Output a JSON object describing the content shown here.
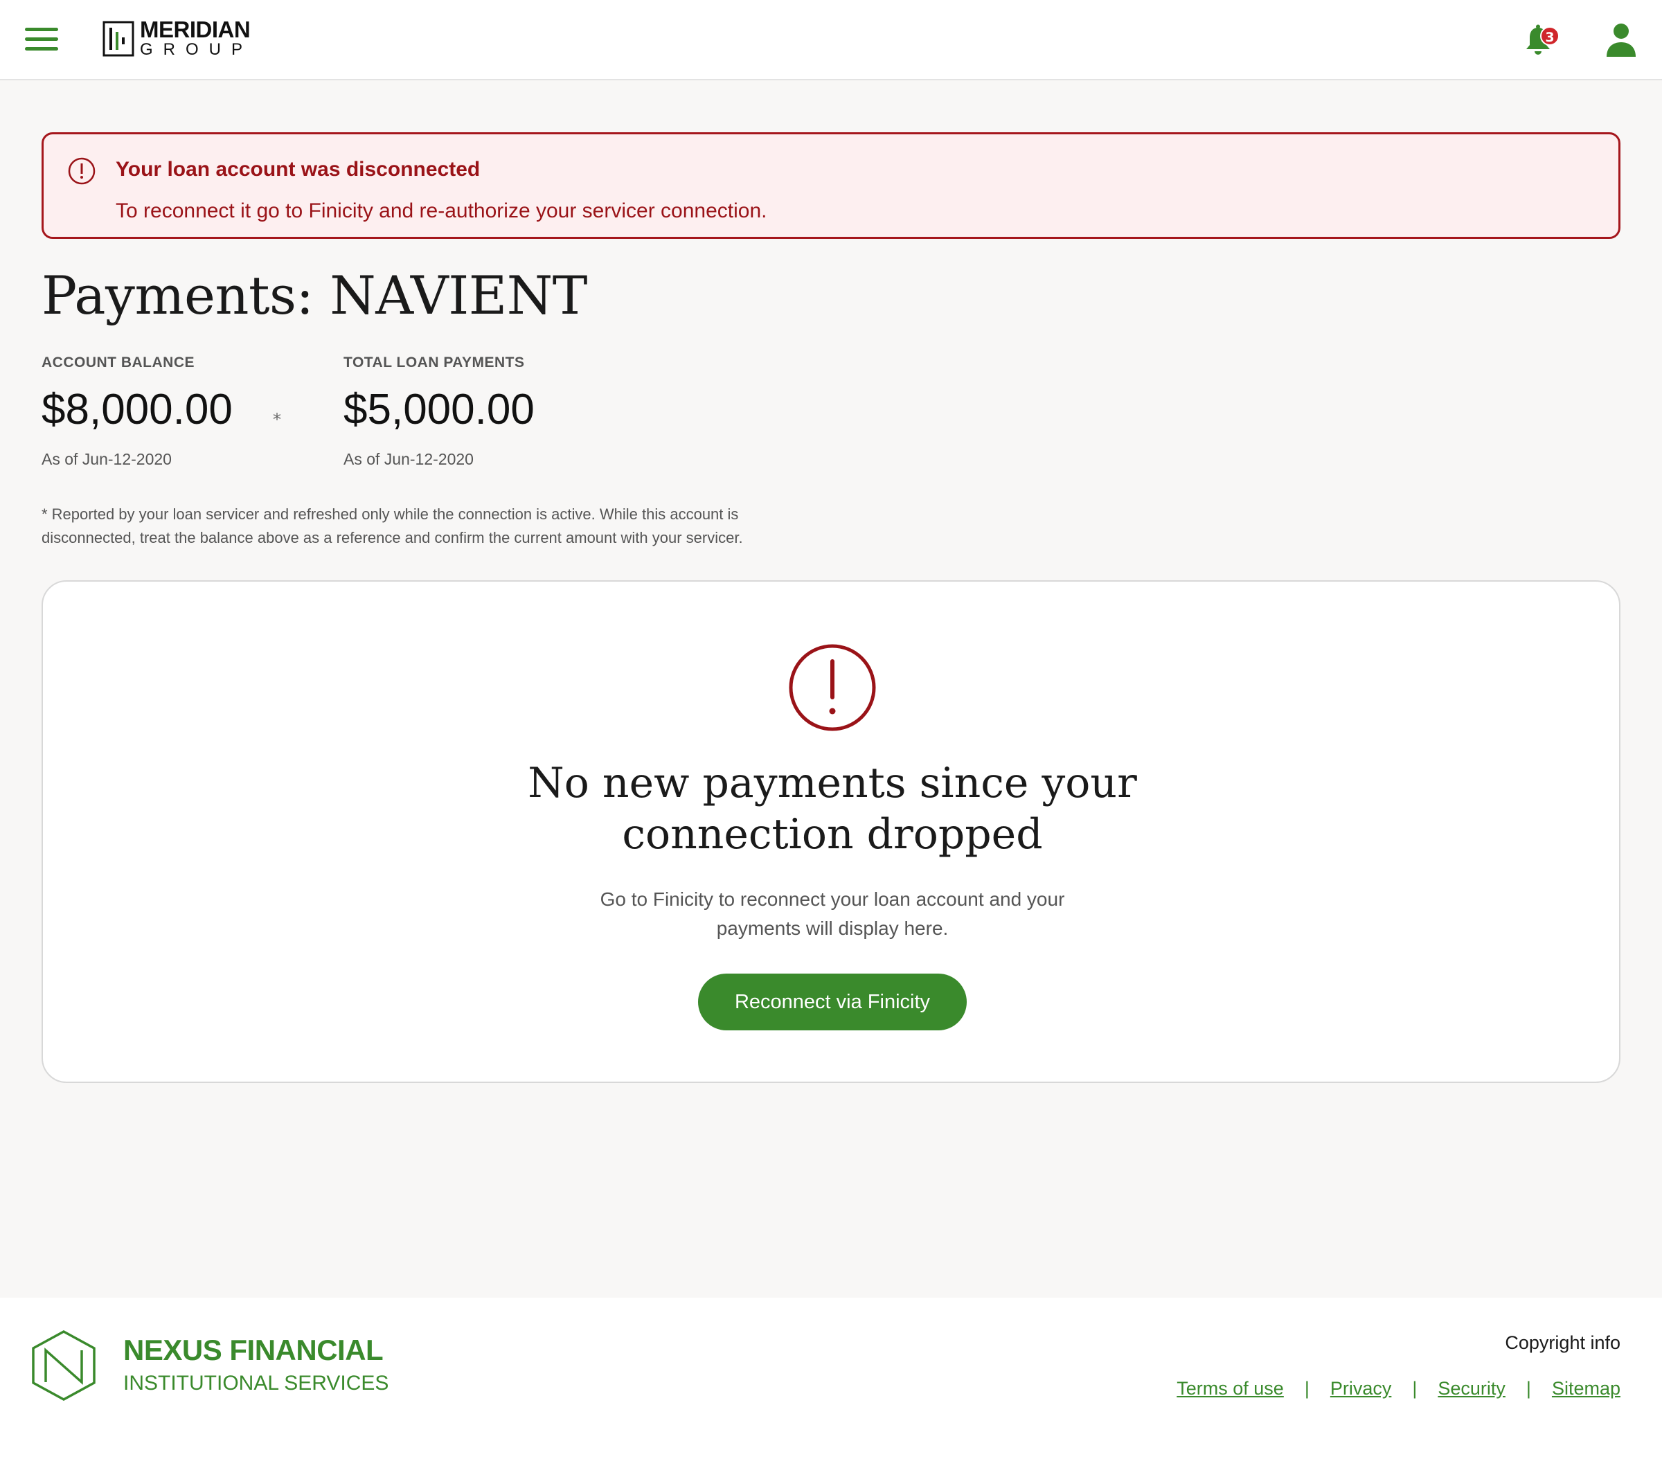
{
  "header": {
    "logo_main": "MERIDIAN",
    "logo_sub": "GROUP",
    "notification_count": "3"
  },
  "alert": {
    "title": "Your loan account was disconnected",
    "message": "To reconnect it go to Finicity and re-authorize your servicer connection."
  },
  "page": {
    "title": "Payments: NAVIENT"
  },
  "stats": {
    "balance_label": "ACCOUNT BALANCE",
    "balance_value": "$8,000.00",
    "balance_marker": "*",
    "balance_date": "As of Jun-12-2020",
    "payments_label": "TOTAL LOAN PAYMENTS",
    "payments_value": "$5,000.00",
    "payments_date": "As of Jun-12-2020"
  },
  "footnote": {
    "line1": "* Reported by your loan servicer and refreshed only while the connection is active. While this account is",
    "line2": "disconnected, treat the balance above as a reference and confirm the current amount with your servicer."
  },
  "empty_state": {
    "title_line1": "No new payments since your",
    "title_line2": "connection dropped",
    "message_line1": "Go to Finicity to reconnect your loan account and your",
    "message_line2": "payments will display here.",
    "button_label": "Reconnect via Finicity"
  },
  "footer": {
    "brand_line1": "NEXUS FINANCIAL",
    "brand_line2": "INSTITUTIONAL SERVICES",
    "copyright": "Copyright info",
    "links": [
      "Terms of use",
      "Privacy",
      "Security",
      "Sitemap"
    ],
    "separator": "|"
  },
  "colors": {
    "brand_green": "#3a8a2c",
    "alert_red": "#9a1318",
    "alert_bg": "#fdeff0",
    "badge_red": "#d0262b"
  },
  "icons": {
    "menu": "hamburger-menu-icon",
    "notifications": "bell-icon",
    "profile": "user-icon",
    "alert": "exclamation-circle-icon",
    "footer_logo": "hexagon-n-logo"
  }
}
